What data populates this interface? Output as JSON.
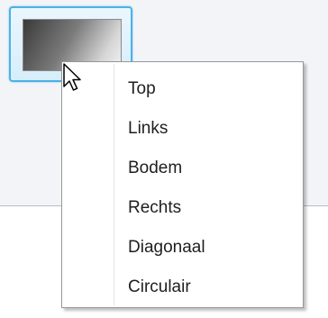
{
  "gradient_button": {
    "icon": "gradient-swatch",
    "style": "dark-to-light diagonal gradient"
  },
  "context_menu": {
    "items": [
      {
        "label": "Top"
      },
      {
        "label": "Links"
      },
      {
        "label": "Bodem"
      },
      {
        "label": "Rechts"
      },
      {
        "label": "Diagonaal"
      },
      {
        "label": "Circulair"
      }
    ]
  },
  "colors": {
    "accent_border": "#49b2e6",
    "menu_background": "#ffffff",
    "menu_border": "#979797",
    "window_background": "#f3f4f8"
  },
  "cursor": {
    "icon": "arrow-pointer"
  }
}
